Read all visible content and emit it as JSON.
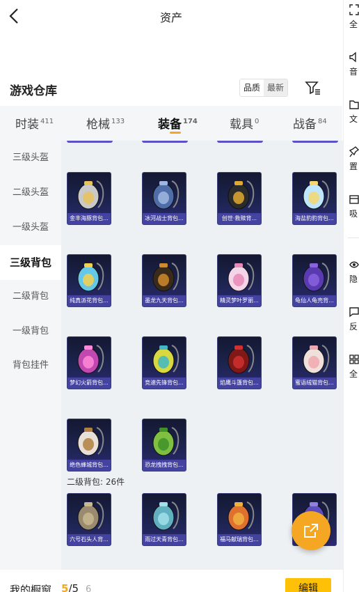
{
  "header": {
    "title": "资产"
  },
  "warehouse": {
    "title": "游戏仓库",
    "sort_options": [
      "品质",
      "最新"
    ]
  },
  "tabs": [
    {
      "label": "时装",
      "count": "411"
    },
    {
      "label": "枪械",
      "count": "133"
    },
    {
      "label": "装备",
      "count": "174"
    },
    {
      "label": "载具",
      "count": "0"
    },
    {
      "label": "战备",
      "count": "84"
    }
  ],
  "categories": [
    "三级头盔",
    "二级头盔",
    "一级头盔",
    "三级背包",
    "二级背包",
    "一级背包",
    "背包挂件"
  ],
  "items": [
    {
      "name": "金丰海豚背包...",
      "color": "#c9c9c9",
      "accent": "#e8c25a"
    },
    {
      "name": "冰河战士背包...",
      "color": "#4f6ea8",
      "accent": "#9fb7e0"
    },
    {
      "name": "创世·救赎背...",
      "color": "#2b2b2b",
      "accent": "#e0a830"
    },
    {
      "name": "海盐豹豹背包...",
      "color": "#bfe6ff",
      "accent": "#f5d76e"
    },
    {
      "name": "纯真派花背包...",
      "color": "#64c8e8",
      "accent": "#f5d050"
    },
    {
      "name": "墨龙九天背包...",
      "color": "#3a2a1a",
      "accent": "#d08a2a"
    },
    {
      "name": "精灵梦叶罗丽...",
      "color": "#f4d4e8",
      "accent": "#e889b8"
    },
    {
      "name": "龟仙人龟壳背...",
      "color": "#5a3ab0",
      "accent": "#8a62e0"
    },
    {
      "name": "梦幻火箭背包...",
      "color": "#c048b0",
      "accent": "#ff8ad8"
    },
    {
      "name": "竞速先锋背包...",
      "color": "#d8d840",
      "accent": "#40b8c8"
    },
    {
      "name": "焰鹰斗篷背包...",
      "color": "#801818",
      "accent": "#d03030"
    },
    {
      "name": "蜜语绒猫背包...",
      "color": "#f0e0dc",
      "accent": "#f0a8b0"
    },
    {
      "name": "绝色蜂城背包...",
      "color": "#e8e0d8",
      "accent": "#b08040"
    },
    {
      "name": "恐龙拽拽背包...",
      "color": "#80c040",
      "accent": "#40902a"
    },
    {
      "name": "六号石头人背...",
      "color": "#9a8a70",
      "accent": "#c8b890"
    },
    {
      "name": "雨过天青背包...",
      "color": "#60b0c0",
      "accent": "#a0e0e8"
    },
    {
      "name": "福马献瑞背包...",
      "color": "#e07030",
      "accent": "#f0b040"
    },
    {
      "name": "",
      "color": "#6050c0",
      "accent": "#9080e0"
    }
  ],
  "section_title": "二级背包: 26件",
  "bottom": {
    "label": "我的橱窗",
    "current": "5",
    "max": "/5",
    "extra": "6",
    "edit_label": "编辑"
  },
  "side_panel": [
    "全",
    "音",
    "文",
    "置",
    "吸",
    "隐",
    "反",
    "全"
  ],
  "colors": {
    "accent": "#f5a623",
    "item_label_bg": "#4a48aa"
  }
}
